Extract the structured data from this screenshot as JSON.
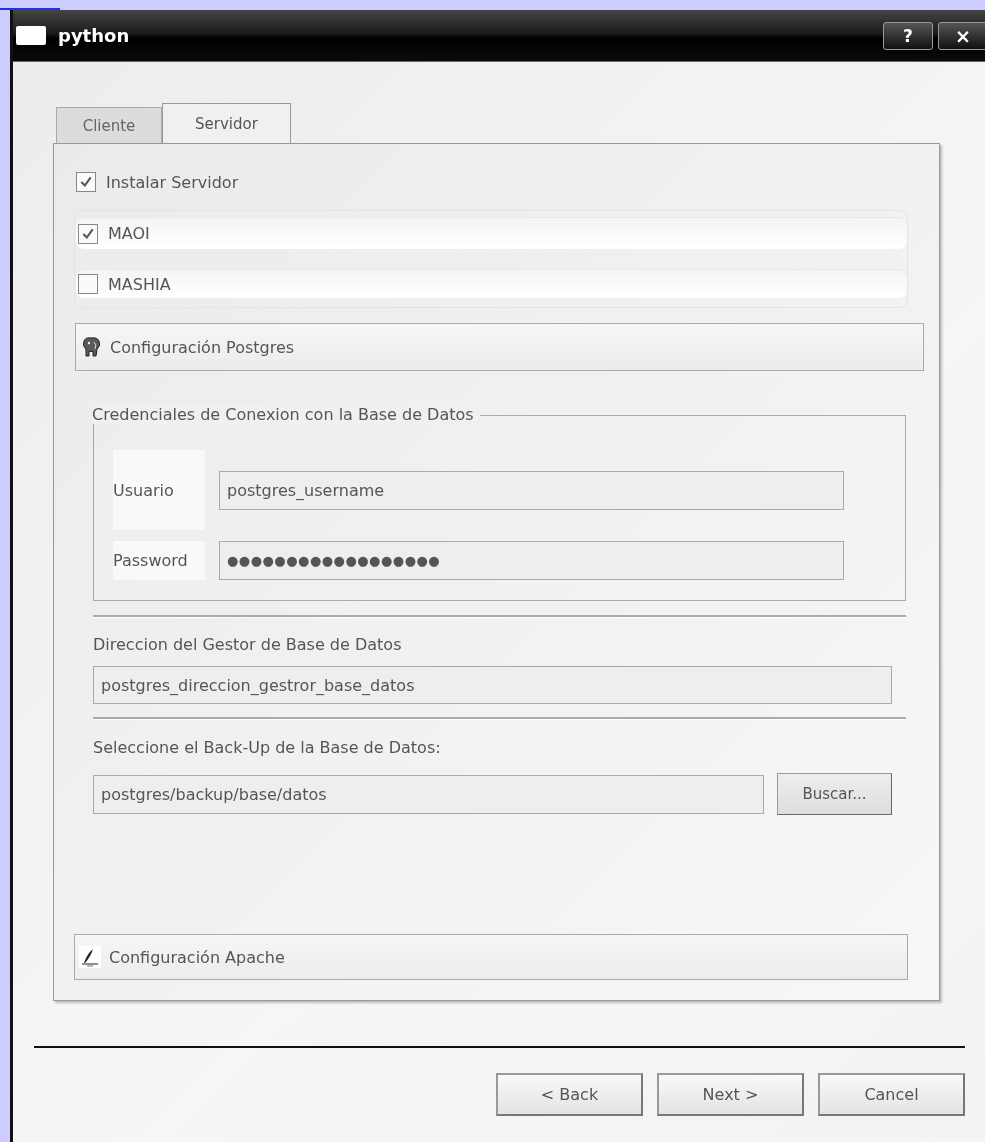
{
  "window": {
    "title": "python",
    "title_buttons": [
      {
        "label": "?",
        "kind": "help"
      },
      {
        "label": "×",
        "kind": "close"
      }
    ]
  },
  "tabs": [
    {
      "label": "Cliente",
      "selected": false
    },
    {
      "label": "Servidor",
      "selected": true
    }
  ],
  "install_server": {
    "label": "Instalar Servidor",
    "checked": true
  },
  "apps": [
    {
      "label": "MAOI",
      "checked": true
    },
    {
      "label": "MASHIA",
      "checked": false
    }
  ],
  "postgres_section": {
    "title": "Configuración Postgres",
    "credentials": {
      "title": "Credenciales de Conexion con la Base de Datos",
      "fields": [
        {
          "label": "Usuario",
          "value": "postgres_username",
          "kind": "text"
        },
        {
          "label": "Password",
          "value": "●●●●●●●●●●●●●●●●●●",
          "kind": "password"
        }
      ]
    },
    "address": {
      "label": "Direccion del Gestor de Base de Datos",
      "value": "postgres_direccion_gestror_base_datos"
    },
    "backup": {
      "label": "Seleccione el Back-Up de la Base de Datos:",
      "value": "postgres/backup/base/datos",
      "button": "Buscar..."
    }
  },
  "apache_section": {
    "title": "Configuración Apache"
  },
  "buttons": [
    {
      "label": "< Back"
    },
    {
      "label": "Next >"
    },
    {
      "label": "Cancel"
    }
  ]
}
